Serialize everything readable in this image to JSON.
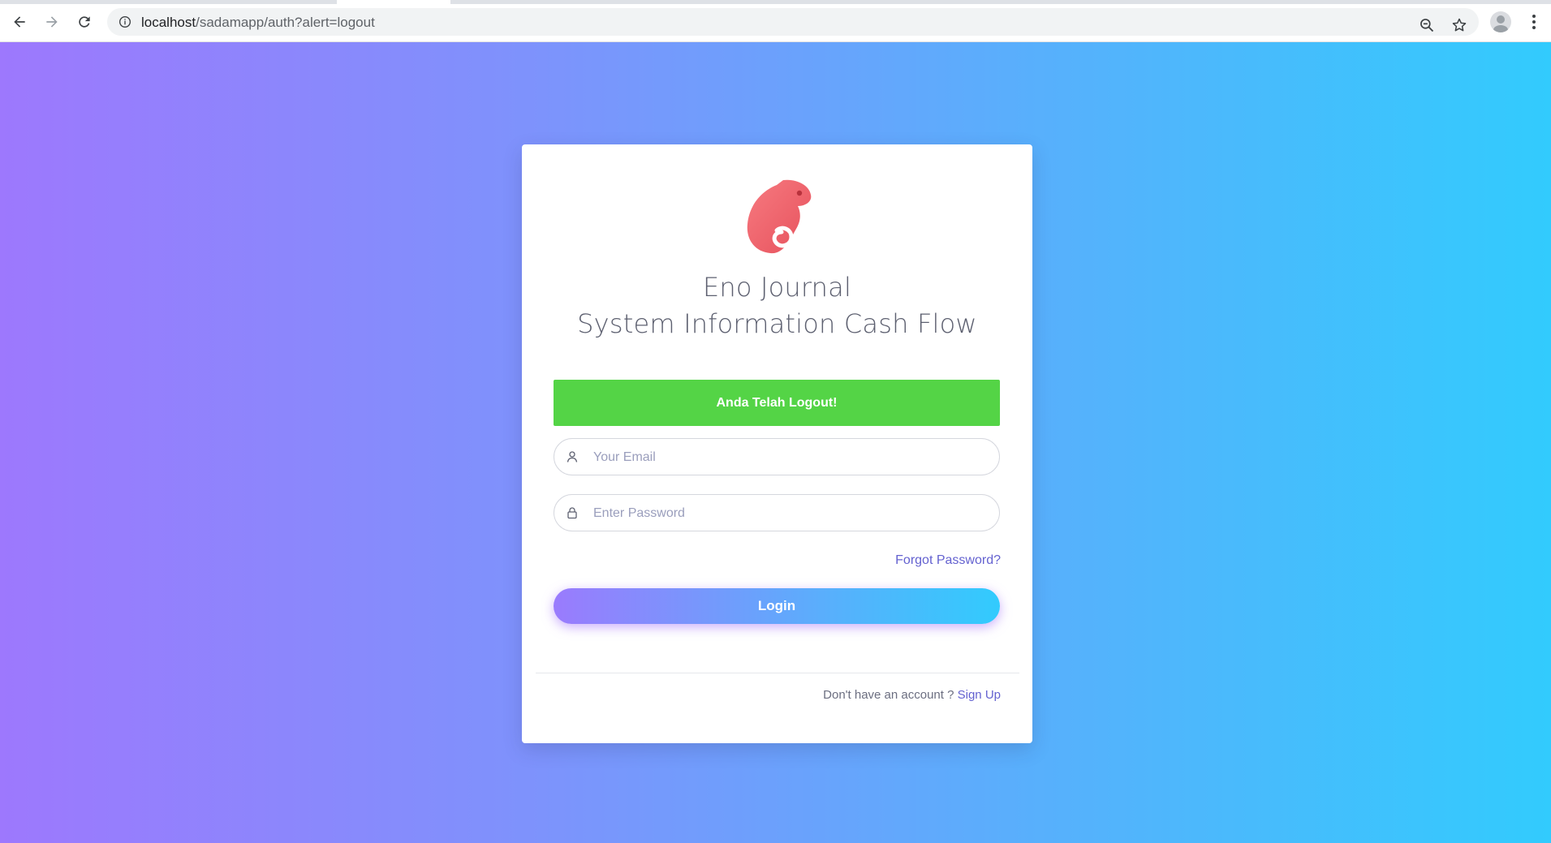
{
  "browser": {
    "url_host": "localhost",
    "url_path": "/sadamapp/auth?alert=logout"
  },
  "card": {
    "title_line1": "Eno Journal",
    "title_line2": "System Information Cash Flow",
    "alert_text": "Anda Telah Logout!",
    "email_placeholder": "Your Email",
    "password_placeholder": "Enter Password",
    "forgot_label": "Forgot Password?",
    "login_label": "Login",
    "signup_prompt": "Don't have an account ?",
    "signup_link": "Sign Up"
  },
  "colors": {
    "alert_bg": "#54d446",
    "link": "#6462d0",
    "logo": "#f0646c",
    "gradient_start": "#9d78fd",
    "gradient_end": "#32cbfd"
  },
  "icons": {
    "back": "arrow-left-icon",
    "forward": "arrow-right-icon",
    "reload": "reload-icon",
    "site_info": "info-icon",
    "zoom": "zoom-icon",
    "bookmark": "star-icon",
    "profile": "profile-icon",
    "menu": "menu-dots-icon",
    "email_field": "user-icon",
    "password_field": "lock-icon",
    "logo": "chameleon-logo-icon"
  }
}
